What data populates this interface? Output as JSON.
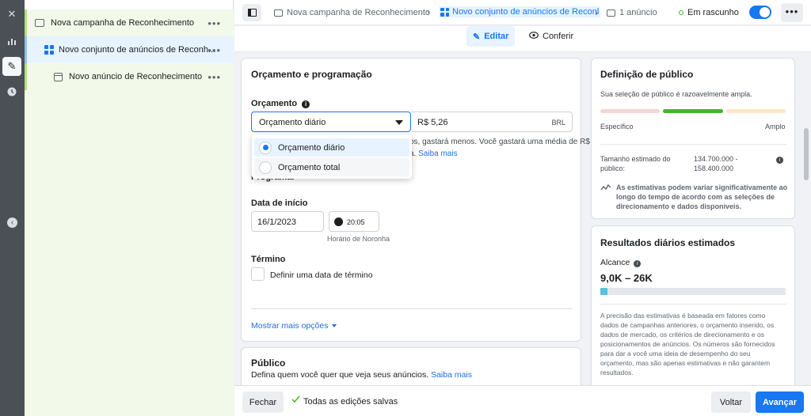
{
  "tree": {
    "campaign": "Nova campanha de Reconhecimento",
    "ad_set": "Novo conjunto de anúncios de Reconh...",
    "ad": "Novo anúncio de Reconhecimento"
  },
  "topbar": {
    "crumb_campaign": "Nova campanha de Reconhecimento",
    "crumb_ad_set": "Novo conjunto de anúncios de Reconl",
    "crumb_ads": "1 anúncio",
    "status": "Em rascunho"
  },
  "modes": {
    "edit": "Editar",
    "review": "Conferir"
  },
  "budget_card": {
    "title": "Orçamento e programação",
    "budget_label": "Orçamento",
    "budget_type": "Orçamento diário",
    "amount": "R$ 5,26",
    "currency": "BRL",
    "hint_line1": "os, gastará menos. Você gastará uma média de R$",
    "hint_line2": "a.",
    "learn_more": "Saiba mais",
    "dropdown_options": [
      "Orçamento diário",
      "Orçamento total"
    ],
    "schedule_label": "Programar",
    "start_label": "Data de início",
    "start_date": "16/1/2023",
    "start_time": "20:05",
    "timezone": "Horário de Noronha",
    "end_label": "Término",
    "end_checkbox": "Definir uma data de término",
    "more_options": "Mostrar mais opções"
  },
  "audience_card": {
    "title": "Público",
    "desc": "Defina quem você quer que veja seus anúncios.",
    "learn_more": "Saiba mais"
  },
  "audience_def": {
    "title": "Definição de público",
    "subtitle": "Sua seleção de público é razoavelmente ampla.",
    "specific": "Específico",
    "broad": "Amplo",
    "size_label_1": "Tamanho estimado do",
    "size_label_2": "público:",
    "size_value_1": "134.700.000 -",
    "size_value_2": "158.400.000",
    "note_1": "As estimativas podem variar significativamente ao",
    "note_2": "longo do tempo de acordo com as seleções de",
    "note_3": "direcionamento e dados disponíveis.",
    "colors": {
      "low": "#f5d5d5",
      "mid": "#42b72a",
      "high": "#fbe8c2"
    }
  },
  "daily_results": {
    "title": "Resultados diários estimados",
    "reach_label": "Alcance",
    "reach_value": "9,0K – 26K",
    "reach_fill": 0.04,
    "disclaimer": [
      "A precisão das estimativas é baseada em fatores como",
      "dados de campanhas anteriores, o orçamento inserido, os",
      "dados de mercado, os critérios de direcionamento e os",
      "posicionamentos de anúncios. Os números são fornecidos",
      "para dar a você uma ideia de desempenho do seu",
      "orçamento, mas são apenas estimativas e não garantem",
      "resultados."
    ]
  },
  "footer": {
    "close": "Fechar",
    "saved": "Todas as edições salvas",
    "back": "Voltar",
    "next": "Avançar"
  },
  "accent": "#1877f2"
}
